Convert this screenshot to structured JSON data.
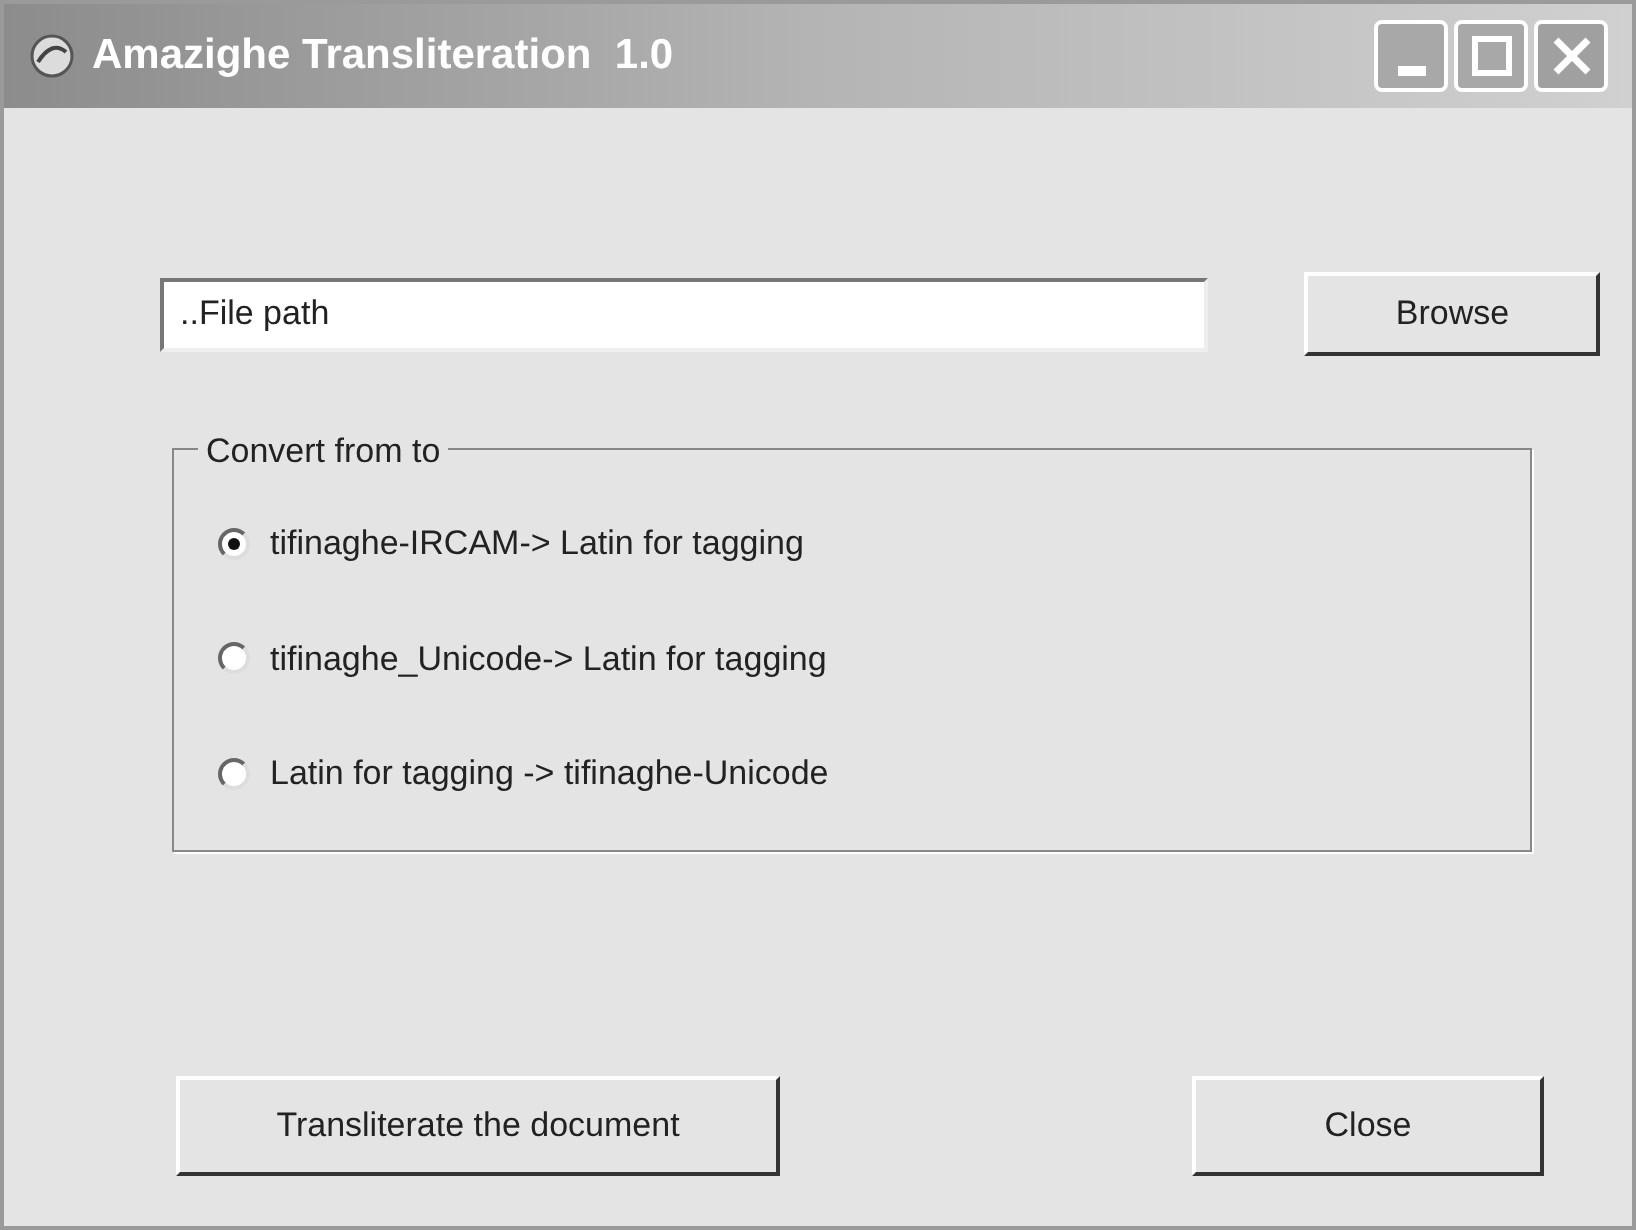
{
  "window": {
    "title": "Amazighe Transliteration  1.0"
  },
  "file_path": {
    "value": "..File path"
  },
  "browse_button": "Browse",
  "group": {
    "title": "Convert from to",
    "options": [
      {
        "label": "tifinaghe-IRCAM-> Latin for tagging",
        "selected": true
      },
      {
        "label": "tifinaghe_Unicode-> Latin for tagging",
        "selected": false
      },
      {
        "label": "Latin for tagging -> tifinaghe-Unicode",
        "selected": false
      }
    ]
  },
  "buttons": [
    "Transliterate the document",
    "Close"
  ]
}
